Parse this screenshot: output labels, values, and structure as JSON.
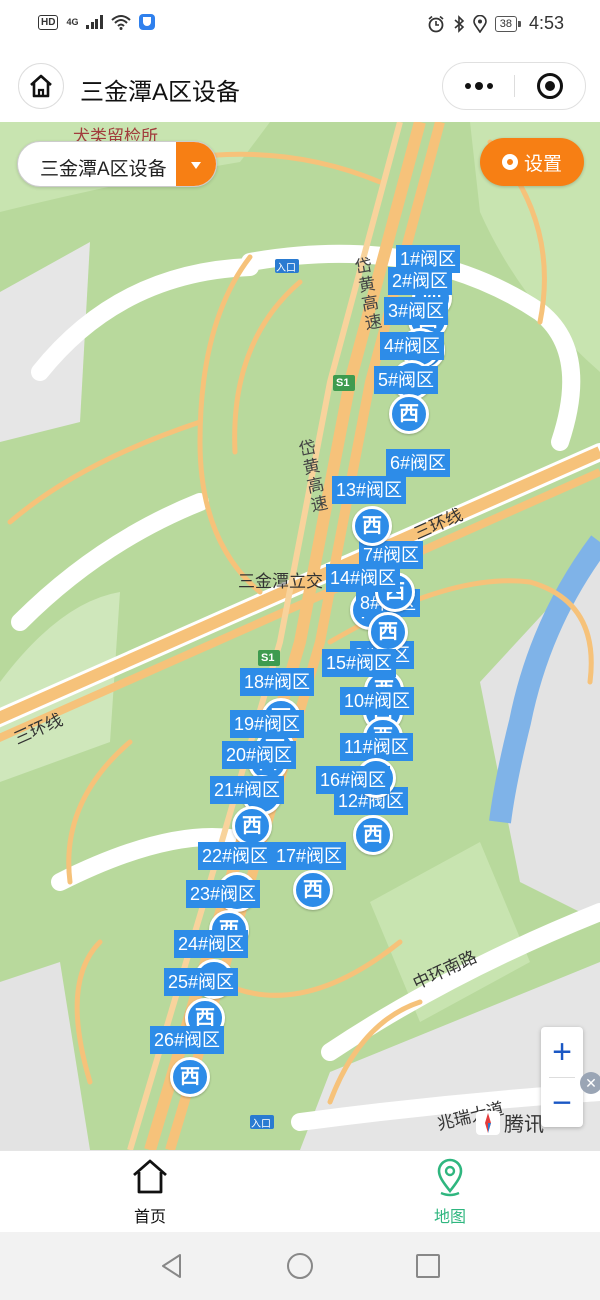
{
  "status_bar": {
    "hd": "HD",
    "network": "4G",
    "battery": "38",
    "time": "4:53",
    "icons": [
      "signal-icon",
      "wifi-icon",
      "shield-icon",
      "alarm-icon",
      "bluetooth-icon",
      "location-icon"
    ]
  },
  "title_bar": {
    "title": "三金潭A区设备",
    "home_icon": "home-icon",
    "more_icon": "more-icon",
    "close_icon": "miniprogram-close-icon"
  },
  "map": {
    "region_select": {
      "value": "三金潭A区设备"
    },
    "settings_label": "设置",
    "zoom_in": "+",
    "zoom_out": "−",
    "logo_text": "腾讯",
    "close_fab": "✕",
    "place_labels": [
      "犬类留检所",
      "入口",
      "入口",
      "岱黄高速",
      "岱黄高速",
      "S1",
      "S1",
      "三环线",
      "三环线",
      "三金潭立交",
      "中环南路",
      "兆瑞大道"
    ],
    "valve_glyph": "西",
    "valves": [
      {
        "label": "1#阀区"
      },
      {
        "label": "2#阀区"
      },
      {
        "label": "3#阀区"
      },
      {
        "label": "4#阀区"
      },
      {
        "label": "5#阀区"
      },
      {
        "label": "6#阀区"
      },
      {
        "label": "7#阀区"
      },
      {
        "label": "8#阀区"
      },
      {
        "label": "9#阀区"
      },
      {
        "label": "10#阀区"
      },
      {
        "label": "11#阀区"
      },
      {
        "label": "12#阀区"
      },
      {
        "label": "13#阀区"
      },
      {
        "label": "14#阀区"
      },
      {
        "label": "15#阀区"
      },
      {
        "label": "16#阀区"
      },
      {
        "label": "17#阀区"
      },
      {
        "label": "18#阀区"
      },
      {
        "label": "19#阀区"
      },
      {
        "label": "20#阀区"
      },
      {
        "label": "21#阀区"
      },
      {
        "label": "22#阀区"
      },
      {
        "label": "23#阀区"
      },
      {
        "label": "24#阀区"
      },
      {
        "label": "25#阀区"
      },
      {
        "label": "26#阀区"
      }
    ]
  },
  "tab_bar": {
    "tabs": [
      {
        "label": "首页",
        "icon": "home-outline-icon",
        "active": false
      },
      {
        "label": "地图",
        "icon": "map-pin-icon",
        "active": true
      }
    ],
    "active_color": "#2fb67f"
  },
  "nav_bar": {
    "icons": [
      "back-icon",
      "home-circle-icon",
      "recents-icon"
    ]
  },
  "colors": {
    "accent": "#f77f14",
    "marker": "#2d8ce8",
    "map_green": "#b8d99c",
    "road": "#f6c27a"
  }
}
